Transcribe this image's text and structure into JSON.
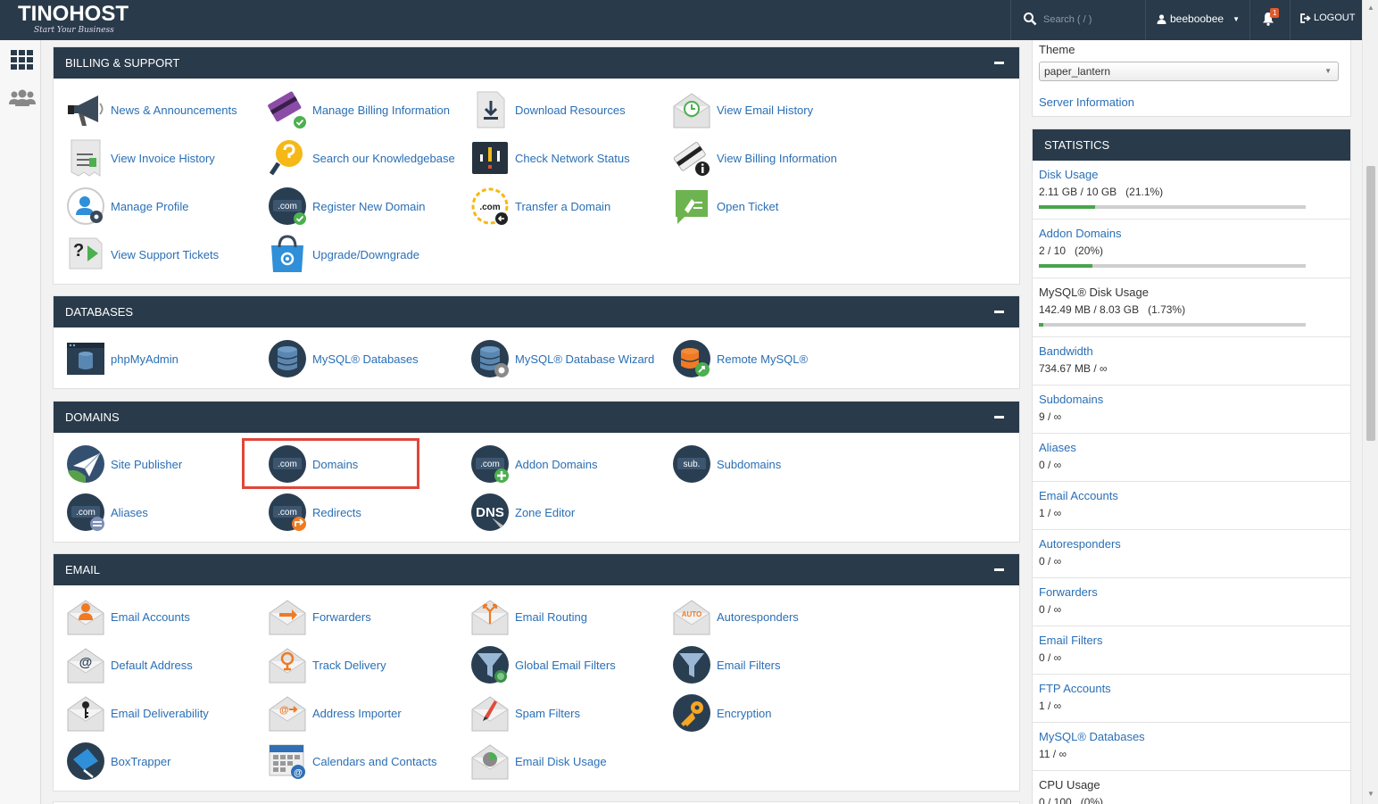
{
  "header": {
    "logo_text": "TINOHOST",
    "logo_tagline": "Start Your Business",
    "search_placeholder": "Search ( / )",
    "username": "beeboobee",
    "notification_count": "1",
    "logout_label": "LOGOUT"
  },
  "panels": {
    "billing": {
      "title": "BILLING & SUPPORT",
      "items": [
        {
          "label": "News & Announcements",
          "icon": "megaphone-icon"
        },
        {
          "label": "Manage Billing Information",
          "icon": "credit-card-icon"
        },
        {
          "label": "Download Resources",
          "icon": "download-icon"
        },
        {
          "label": "View Email History",
          "icon": "email-history-icon"
        },
        {
          "label": "View Invoice History",
          "icon": "invoice-icon"
        },
        {
          "label": "Search our Knowledgebase",
          "icon": "knowledgebase-icon"
        },
        {
          "label": "Check Network Status",
          "icon": "network-status-icon"
        },
        {
          "label": "View Billing Information",
          "icon": "billing-info-icon"
        },
        {
          "label": "Manage Profile",
          "icon": "profile-icon"
        },
        {
          "label": "Register New Domain",
          "icon": "register-domain-icon"
        },
        {
          "label": "Transfer a Domain",
          "icon": "transfer-domain-icon"
        },
        {
          "label": "Open Ticket",
          "icon": "ticket-icon"
        },
        {
          "label": "View Support Tickets",
          "icon": "support-tickets-icon"
        },
        {
          "label": "Upgrade/Downgrade",
          "icon": "upgrade-icon"
        }
      ]
    },
    "databases": {
      "title": "DATABASES",
      "items": [
        {
          "label": "phpMyAdmin",
          "icon": "phpmyadmin-icon"
        },
        {
          "label": "MySQL® Databases",
          "icon": "mysql-databases-icon"
        },
        {
          "label": "MySQL® Database Wizard",
          "icon": "mysql-wizard-icon"
        },
        {
          "label": "Remote MySQL®",
          "icon": "remote-mysql-icon"
        }
      ]
    },
    "domains": {
      "title": "DOMAINS",
      "items": [
        {
          "label": "Site Publisher",
          "icon": "site-publisher-icon"
        },
        {
          "label": "Domains",
          "icon": "domains-icon",
          "icon_text": ".com"
        },
        {
          "label": "Addon Domains",
          "icon": "addon-domains-icon",
          "icon_text": ".com"
        },
        {
          "label": "Subdomains",
          "icon": "subdomains-icon",
          "icon_text": "sub."
        },
        {
          "label": "Aliases",
          "icon": "aliases-icon",
          "icon_text": ".com"
        },
        {
          "label": "Redirects",
          "icon": "redirects-icon",
          "icon_text": ".com"
        },
        {
          "label": "Zone Editor",
          "icon": "zone-editor-icon",
          "icon_text": "DNS"
        }
      ]
    },
    "email": {
      "title": "EMAIL",
      "items": [
        {
          "label": "Email Accounts",
          "icon": "email-accounts-icon"
        },
        {
          "label": "Forwarders",
          "icon": "forwarders-icon"
        },
        {
          "label": "Email Routing",
          "icon": "email-routing-icon"
        },
        {
          "label": "Autoresponders",
          "icon": "autoresponders-icon",
          "icon_text": "AUTO"
        },
        {
          "label": "Default Address",
          "icon": "default-address-icon"
        },
        {
          "label": "Track Delivery",
          "icon": "track-delivery-icon"
        },
        {
          "label": "Global Email Filters",
          "icon": "global-filters-icon"
        },
        {
          "label": "Email Filters",
          "icon": "email-filters-icon"
        },
        {
          "label": "Email Deliverability",
          "icon": "deliverability-icon"
        },
        {
          "label": "Address Importer",
          "icon": "address-importer-icon"
        },
        {
          "label": "Spam Filters",
          "icon": "spam-filters-icon"
        },
        {
          "label": "Encryption",
          "icon": "encryption-icon"
        },
        {
          "label": "BoxTrapper",
          "icon": "boxtrapper-icon"
        },
        {
          "label": "Calendars and Contacts",
          "icon": "calendar-icon"
        },
        {
          "label": "Email Disk Usage",
          "icon": "email-disk-usage-icon"
        }
      ]
    }
  },
  "sidebar": {
    "theme_label": "Theme",
    "theme_value": "paper_lantern",
    "server_info_label": "Server Information",
    "stats_title": "STATISTICS",
    "stats": [
      {
        "label": "Disk Usage",
        "value": "2.11 GB / 10 GB   (21.1%)",
        "percent": 21.1,
        "link": true
      },
      {
        "label": "Addon Domains",
        "value": "2 / 10   (20%)",
        "percent": 20,
        "link": true
      },
      {
        "label": "MySQL® Disk Usage",
        "value": "142.49 MB / 8.03 GB   (1.73%)",
        "percent": 1.73,
        "link": false
      },
      {
        "label": "Bandwidth",
        "value": "734.67 MB / ∞",
        "link": true
      },
      {
        "label": "Subdomains",
        "value": "9 / ∞",
        "link": true
      },
      {
        "label": "Aliases",
        "value": "0 / ∞",
        "link": true
      },
      {
        "label": "Email Accounts",
        "value": "1 / ∞",
        "link": true
      },
      {
        "label": "Autoresponders",
        "value": "0 / ∞",
        "link": true
      },
      {
        "label": "Forwarders",
        "value": "0 / ∞",
        "link": true
      },
      {
        "label": "Email Filters",
        "value": "0 / ∞",
        "link": true
      },
      {
        "label": "FTP Accounts",
        "value": "1 / ∞",
        "link": true
      },
      {
        "label": "MySQL® Databases",
        "value": "11 / ∞",
        "link": true
      },
      {
        "label": "CPU Usage",
        "value": "0 / 100   (0%)",
        "link": false
      }
    ]
  },
  "colors": {
    "header_bg": "#293a4a",
    "link": "#2a6fb5",
    "highlight": "#e0463a",
    "bar_fill": "#49a54b"
  }
}
